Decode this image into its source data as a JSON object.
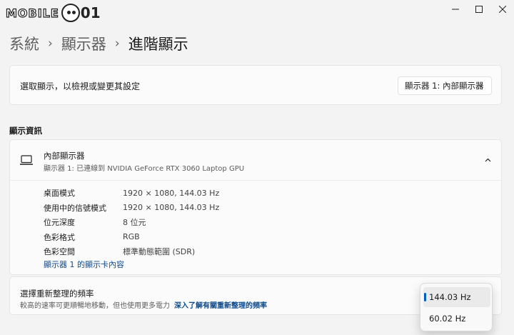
{
  "logo": {
    "text": "MOBILE",
    "mark": "01"
  },
  "window": {
    "controls": [
      "minimize-icon",
      "maximize-icon",
      "close-icon"
    ]
  },
  "breadcrumb": {
    "items": [
      "系統",
      "顯示器",
      "進階顯示"
    ],
    "separator": "›"
  },
  "select_display": {
    "label": "選取顯示，以檢視或變更其設定",
    "value": "顯示器 1: 內部顯示器"
  },
  "display_info": {
    "section_title": "顯示資訊",
    "name": "內部顯示器",
    "subtitle": "顯示器 1: 已連線到 NVIDIA GeForce RTX 3060 Laptop GPU",
    "rows": [
      {
        "key": "桌面模式",
        "value": "1920 × 1080, 144.03 Hz"
      },
      {
        "key": "使用中的信號模式",
        "value": "1920 × 1080, 144.03 Hz"
      },
      {
        "key": "位元深度",
        "value": "8 位元"
      },
      {
        "key": "色彩格式",
        "value": "RGB"
      },
      {
        "key": "色彩空間",
        "value": "標準動態範圍 (SDR)"
      }
    ],
    "adapter_link": "顯示器 1 的顯示卡內容"
  },
  "refresh_rate": {
    "title": "選擇重新整理的頻率",
    "description": "較高的速率可更順暢地移動，但也使用更多電力",
    "link": "深入了解有關重新整理的頻率",
    "options": [
      "144.03 Hz",
      "60.02 Hz"
    ],
    "selected": "144.03 Hz"
  },
  "colors": {
    "accent": "#005fb8",
    "link": "#0f4a8c"
  }
}
